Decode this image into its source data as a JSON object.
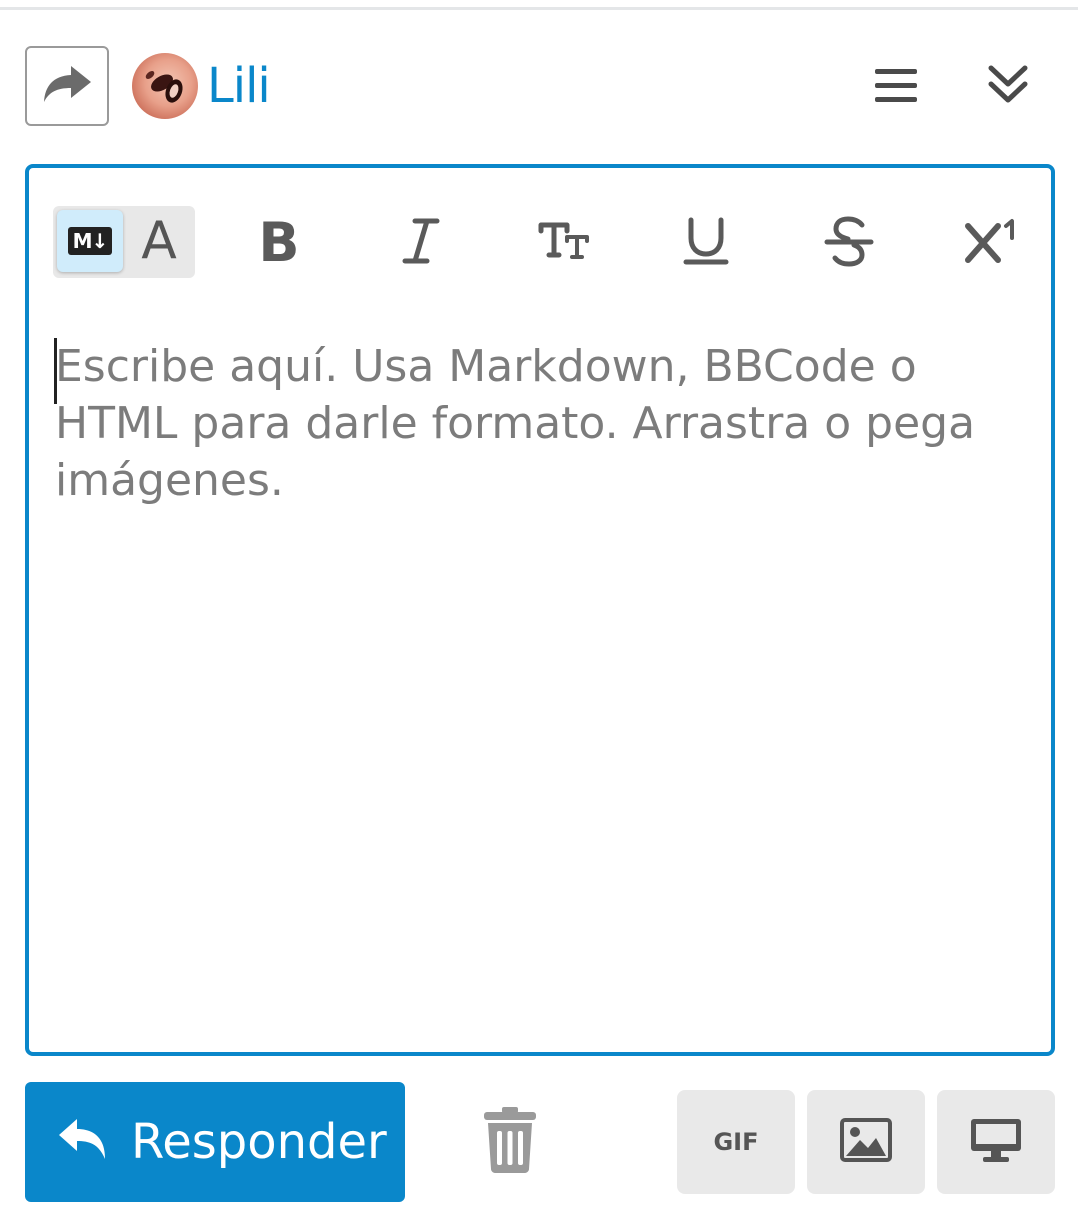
{
  "header": {
    "username": "Lili",
    "reply_type_icon": "share-arrow-icon",
    "menu_icon": "hamburger-icon",
    "collapse_icon": "double-chevron-down-icon"
  },
  "editor": {
    "mode_toggle": {
      "markdown_badge": "M↓",
      "rich_text_label": "A",
      "active": "markdown"
    },
    "toolbar": [
      {
        "name": "bold",
        "glyph": "B"
      },
      {
        "name": "italic",
        "glyph": "I"
      },
      {
        "name": "heading",
        "glyph": "TT"
      },
      {
        "name": "underline",
        "glyph": "U"
      },
      {
        "name": "strikethrough",
        "glyph": "S"
      },
      {
        "name": "superscript",
        "glyph": "X¹"
      }
    ],
    "placeholder": "Escribe aquí. Usa Markdown, BBCode o HTML para darle formato. Arrastra o pega imágenes.",
    "value": ""
  },
  "footer": {
    "reply_label": "Responder",
    "gif_label": "GIF"
  },
  "colors": {
    "accent": "#0a87ca",
    "icon_gray": "#5a5a5a",
    "button_gray": "#e9e9e9"
  }
}
